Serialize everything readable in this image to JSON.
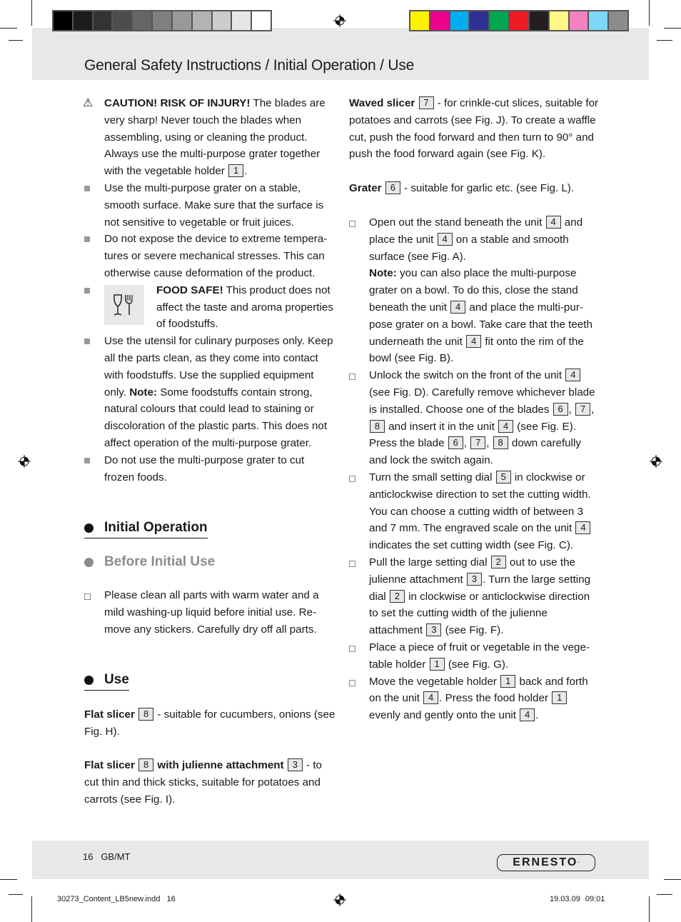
{
  "print_marks": {
    "grayscale_swatches": [
      "#000000",
      "#1c1c1c",
      "#333333",
      "#4d4d4d",
      "#666666",
      "#808080",
      "#999999",
      "#b3b3b3",
      "#cccccc",
      "#e6e6e6",
      "#ffffff"
    ],
    "color_swatches": [
      "#fff200",
      "#ec008c",
      "#00aeef",
      "#2e3192",
      "#00a651",
      "#ed1c24",
      "#231f20",
      "#fff685",
      "#f282c1",
      "#7dd7f7",
      "#8c8c8c"
    ]
  },
  "header": {
    "title": "General Safety Instructions / Initial Operation / Use"
  },
  "left": {
    "caution": {
      "title": "CAUTION! RISK OF INJURY!",
      "text_a": " The blades are very sharp! Never touch the blades when assembling, using or cleaning the product. Always use the multi-purpose grater together with the vegetable holder ",
      "ref": "1",
      "text_b": "."
    },
    "bullet_stable": "Use the multi-purpose grater on a stable, smooth surface. Make sure that the surface is not sensitive to vegetable or fruit juices.",
    "bullet_temperature": "Do not expose the device to extreme tempera-tures or severe mechanical stresses. This can otherwise cause deformation of the product.",
    "food_safe": {
      "title": "FOOD SAFE!",
      "text": " This product does not affect the taste and aroma properties of foodstuffs."
    },
    "bullet_culinary": {
      "text": "Use the utensil for culinary purposes only. Keep all the parts clean, as they come into contact with foodstuffs. Use the supplied equipment only. ",
      "note_label": "Note:",
      "note_text": " Some foodstuffs contain strong, natural colours that could lead to staining or discoloration of the plastic parts. This does not affect operation of the multi-purpose grater."
    },
    "bullet_frozen": "Do not use the multi-purpose grater to cut frozen foods.",
    "heading_initial_operation": "Initial Operation",
    "heading_before_initial_use": "Before Initial Use",
    "before_use_step": "Please clean all parts with warm water and a mild washing-up liquid before initial use. Re-move any stickers. Carefully dry off all parts.",
    "heading_use": "Use",
    "flat_slicer": {
      "title": "Flat slicer",
      "ref": "8",
      "text": " - suitable for cucumbers, onions (see Fig. H)."
    },
    "flat_slicer_julienne": {
      "title": "Flat slicer",
      "ref1": "8",
      "title2": "with julienne attachment",
      "ref2": "3",
      "text": " - to cut thin and thick sticks, suitable for potatoes and carrots (see Fig. I)."
    }
  },
  "right": {
    "waved_slicer": {
      "title": "Waved slicer",
      "ref": "7",
      "text": " - for crinkle-cut slices, suitable for potatoes and carrots (see Fig. J). To create a waffle cut, push the food forward and then turn to 90° and push the food forward again (see Fig. K)."
    },
    "grater": {
      "title": "Grater",
      "ref": "6",
      "text": " - suitable for garlic etc. (see Fig. L)."
    },
    "step1": {
      "t1": "Open out the stand beneath the unit ",
      "r1": "4",
      "t2": " and place the unit ",
      "r2": "4",
      "t3": " on a stable and smooth surface (see Fig. A).",
      "note_label": "Note:",
      "t4": " you can also place the multi-purpose grater on a bowl. To do this, close the stand beneath the unit ",
      "r3": "4",
      "t5": " and place the multi-pur-pose grater on a bowl. Take care that the teeth underneath the unit ",
      "r4": "4",
      "t6": " fit onto the rim of the bowl (see Fig. B)."
    },
    "step2": {
      "t1": "Unlock the switch on the front of the unit ",
      "r1": "4",
      "t2": " (see Fig. D). Carefully remove whichever blade is installed. Choose one of the blades ",
      "r2": "6",
      "r3": "7",
      "r4": "8",
      "t3": " and insert it in the unit ",
      "r5": "4",
      "t4": " (see Fig. E). Press the blade ",
      "r6": "6",
      "r7": "7",
      "r8": "8",
      "t5": " down carefully and lock the switch again.",
      "sep": ", "
    },
    "step3": {
      "t1": "Turn the small setting dial ",
      "r1": "5",
      "t2": " in clockwise or anticlockwise direction to set the cutting width. You can choose a cutting width of between 3 and 7 mm. The engraved scale on the unit ",
      "r2": "4",
      "t3": " indicates the set cutting width (see Fig. C)."
    },
    "step4": {
      "t1": "Pull the large setting dial ",
      "r1": "2",
      "t2": " out to use the julienne attachment ",
      "r2": "3",
      "t3": ". Turn the large setting dial ",
      "r3": "2",
      "t4": " in clockwise or anticlockwise direction to set the cutting width of the julienne attachment ",
      "r4": "3",
      "t5": " (see Fig. F)."
    },
    "step5": {
      "t1": "Place a piece of fruit or vegetable in the vege-table holder ",
      "r1": "1",
      "t2": " (see Fig. G)."
    },
    "step6": {
      "t1": "Move the vegetable holder ",
      "r1": "1",
      "t2": " back and forth on the unit ",
      "r2": "4",
      "t3": ". Press the food holder ",
      "r3": "1",
      "t4": " evenly and gently onto the unit ",
      "r4": "4",
      "t5": "."
    }
  },
  "footer": {
    "page_number": "16",
    "region": "GB/MT",
    "brand": "ERNESTO",
    "slug_file": "30273_Content_LB5new.indd   16",
    "slug_datetime": "19.03.09 09:01"
  }
}
